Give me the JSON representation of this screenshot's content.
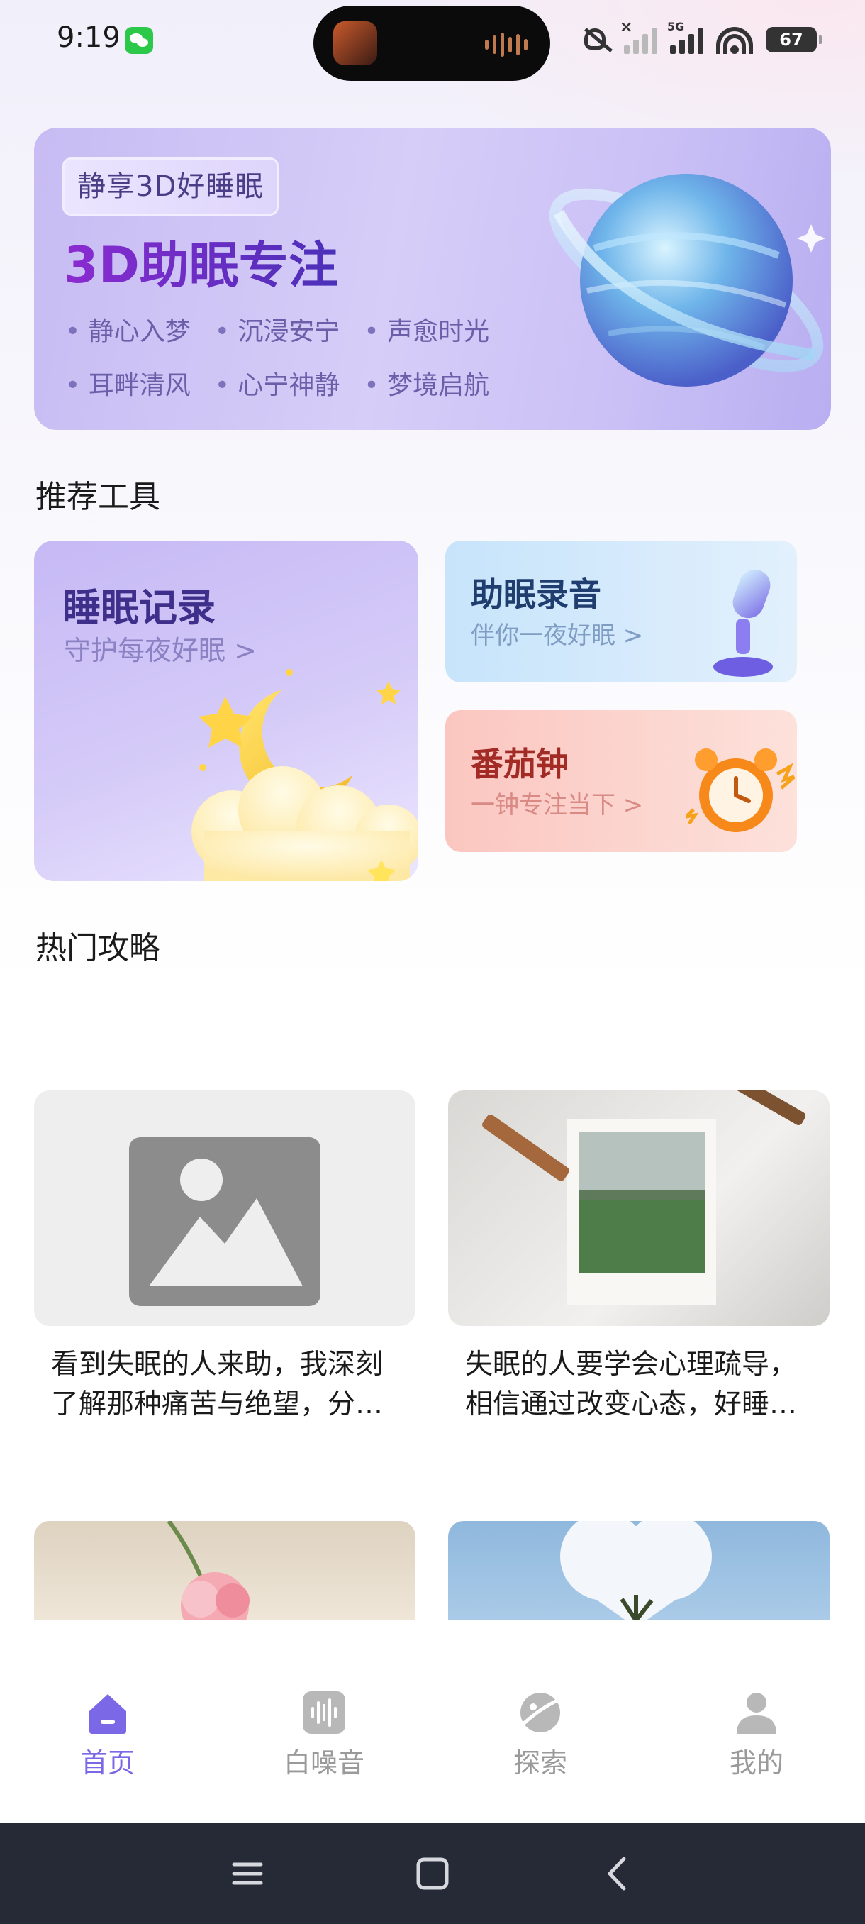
{
  "status_bar": {
    "time": "9:19",
    "network": "5G",
    "battery": "67"
  },
  "banner": {
    "tag": "静享3D好睡眠",
    "title": "3D助眠专注",
    "keywords_row1": [
      "静心入梦",
      "沉浸安宁",
      "声愈时光"
    ],
    "keywords_row2": [
      "耳畔清风",
      "心宁神静",
      "梦境启航"
    ]
  },
  "tools": {
    "section_title": "推荐工具",
    "sleep_record": {
      "title": "睡眠记录",
      "subtitle": "守护每夜好眠 >"
    },
    "sleep_recording": {
      "title": "助眠录音",
      "subtitle": "伴你一夜好眠 >"
    },
    "pomodoro": {
      "title": "番茄钟",
      "subtitle": "一钟专注当下 >"
    }
  },
  "articles": {
    "section_title": "热门攻略",
    "items": [
      {
        "line1": "看到失眠的人来助，我深刻",
        "line2": "了解那种痛苦与绝望，分…"
      },
      {
        "line1": "失眠的人要学会心理疏导，",
        "line2": "相信通过改变心态，好睡…"
      }
    ]
  },
  "tabbar": {
    "items": [
      {
        "label": "首页",
        "icon": "home-icon",
        "active": true
      },
      {
        "label": "白噪音",
        "icon": "white-noise-icon",
        "active": false
      },
      {
        "label": "探索",
        "icon": "explore-icon",
        "active": false
      },
      {
        "label": "我的",
        "icon": "profile-icon",
        "active": false
      }
    ]
  },
  "system_nav": [
    "menu-icon",
    "home-square-icon",
    "back-icon"
  ],
  "colors": {
    "accent": "#7a68e6",
    "tab_inactive": "#9a9a9a",
    "banner_bg": "#cfc5f6",
    "sleep_card": "#c6b9f5",
    "recording_card": "#c7e4fb",
    "pomodoro_card": "#fbc6c0",
    "nav_bar": "#262a36"
  }
}
